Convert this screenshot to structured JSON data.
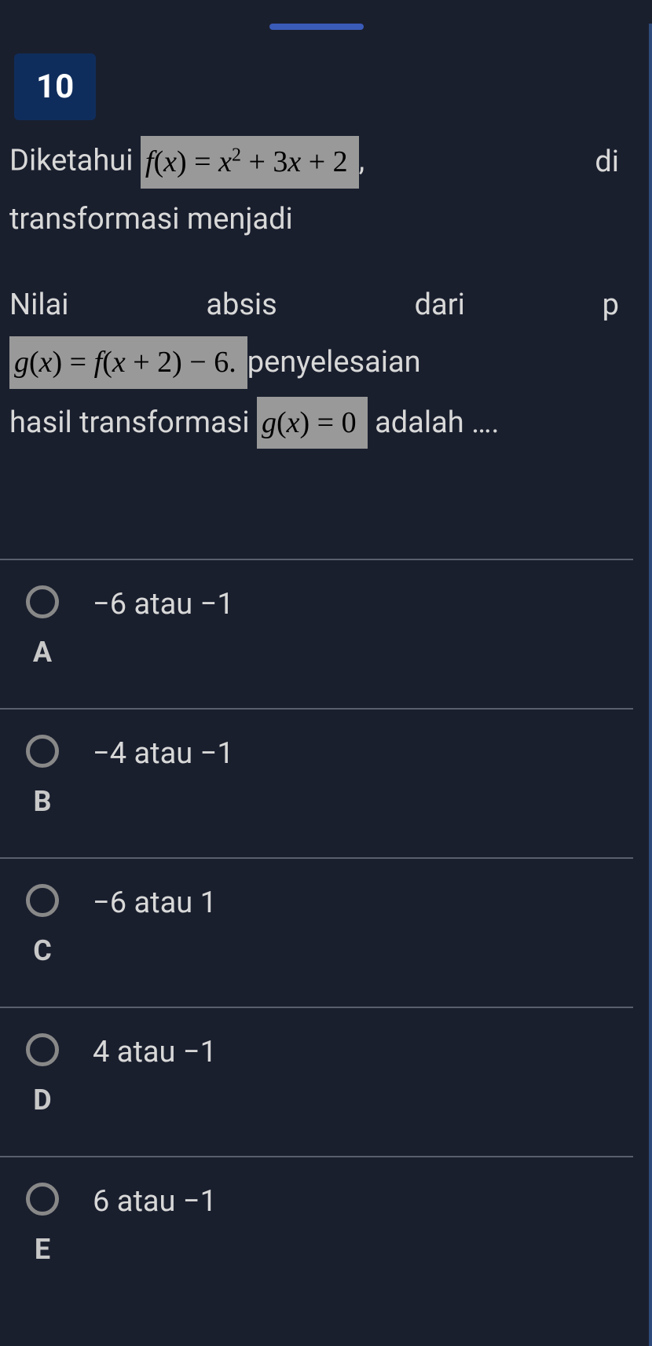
{
  "question": {
    "number": "10",
    "text_before_formula1": "Diketahui",
    "formula1": "f(x) = x² + 3x + 2",
    "text_after_formula1": "di",
    "line2": "transformasi menjadi",
    "line3_word1": "Nilai",
    "line3_word2": "absis",
    "line3_word3": "dari",
    "line3_word4": "p",
    "formula2": "g(x) = f(x + 2) − 6.",
    "text_after_formula2": "penyelesaian",
    "line5_before": "hasil transformasi",
    "formula3": "g(x) = 0",
    "line5_after": "adalah …."
  },
  "options": [
    {
      "letter": "A",
      "text": "−6 atau −1"
    },
    {
      "letter": "B",
      "text": "−4 atau −1"
    },
    {
      "letter": "C",
      "text": "−6 atau 1"
    },
    {
      "letter": "D",
      "text": "4 atau −1"
    },
    {
      "letter": "E",
      "text": "6 atau −1"
    }
  ]
}
